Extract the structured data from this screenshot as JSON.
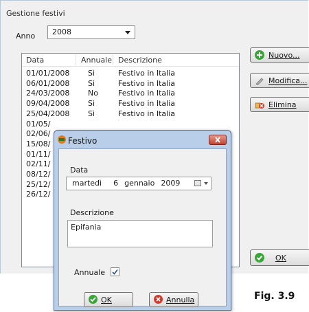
{
  "window": {
    "title": "Gestione festivi"
  },
  "anno": {
    "label": "Anno",
    "value": "2008"
  },
  "list": {
    "headers": [
      "Data",
      "Annuale",
      "Descrizione"
    ],
    "rows": [
      [
        "01/01/2008",
        "Sì",
        "Festivo in Italia"
      ],
      [
        "06/01/2008",
        "Sì",
        "Festivo in Italia"
      ],
      [
        "24/03/2008",
        "No",
        "Festivo in Italia"
      ],
      [
        "09/04/2008",
        "Sì",
        "Festivo in Italia"
      ],
      [
        "25/04/2008",
        "Sì",
        "Festivo in Italia"
      ],
      [
        "01/05/",
        "",
        ""
      ],
      [
        "02/06/",
        "",
        ""
      ],
      [
        "15/08/",
        "",
        ""
      ],
      [
        "01/11/",
        "",
        ""
      ],
      [
        "02/11/",
        "",
        ""
      ],
      [
        "08/12/",
        "",
        ""
      ],
      [
        "25/12/",
        "",
        ""
      ],
      [
        "26/12/",
        "",
        ""
      ]
    ]
  },
  "buttons": {
    "nuovo": "Nuovo...",
    "modifica": "Modifica...",
    "elimina": "Elimina",
    "ok": "OK"
  },
  "dialog": {
    "title": "Festivo",
    "data_label": "Data",
    "date": {
      "weekday": "martedì",
      "day": "6",
      "month": "gennaio",
      "year": "2009"
    },
    "descrizione_label": "Descrizione",
    "descrizione_value": "Epifania",
    "annuale_label": "Annuale",
    "annuale_checked": true,
    "ok": "OK",
    "annulla": "Annulla"
  },
  "caption": "Fig. 3.9",
  "colors": {
    "ok_green": "#3aa63a",
    "delete_red": "#d23c2c",
    "close_red": "#c4422f"
  },
  "icons": {
    "nuovo": "plus-circle-icon",
    "modifica": "pencil-icon",
    "elimina": "delete-icon",
    "ok": "check-circle-icon",
    "annulla": "x-circle-icon"
  }
}
